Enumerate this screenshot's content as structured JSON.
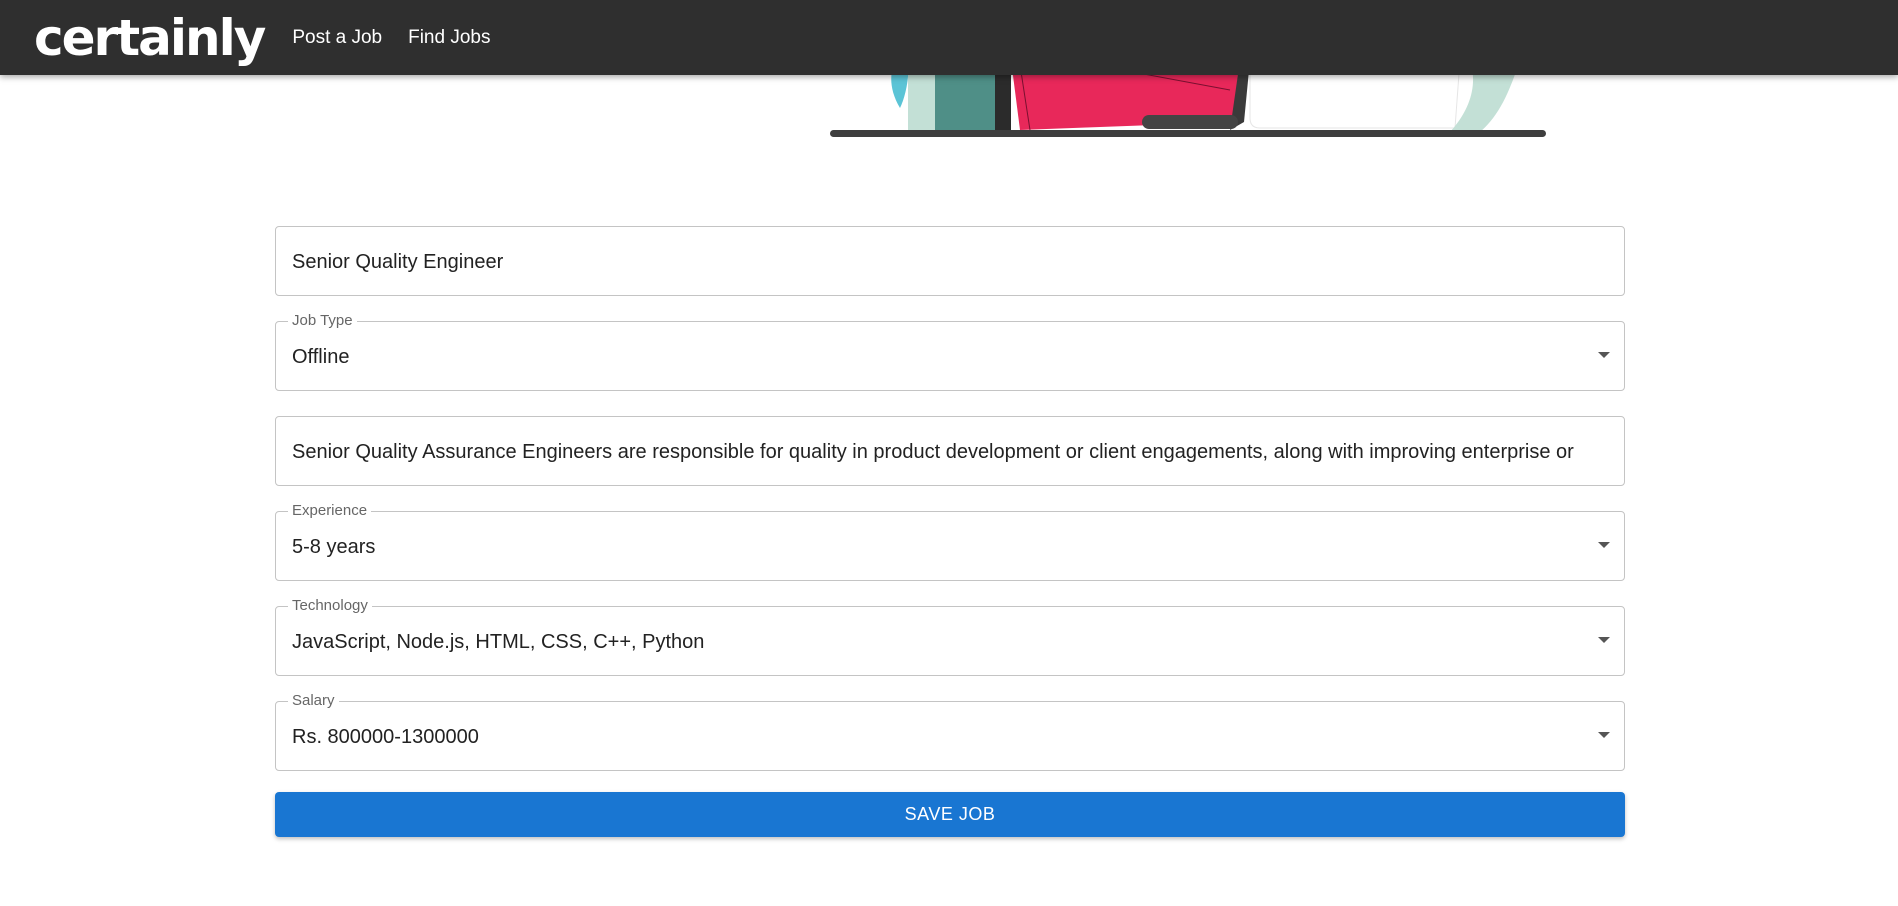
{
  "header": {
    "logo": "certainly",
    "nav": [
      {
        "label": "Post a Job"
      },
      {
        "label": "Find Jobs"
      }
    ]
  },
  "form": {
    "title": {
      "value": "Senior Quality Engineer"
    },
    "job_type": {
      "label": "Job Type",
      "value": "Offline"
    },
    "description": {
      "value": "Senior Quality Assurance Engineers are responsible for quality in product development or client engagements, along with improving enterprise or"
    },
    "experience": {
      "label": "Experience",
      "value": "5-8 years"
    },
    "technology": {
      "label": "Technology",
      "value": "JavaScript, Node.js, HTML, CSS, C++, Python"
    },
    "salary": {
      "label": "Salary",
      "value": "Rs. 800000-1300000"
    },
    "save_label": "SAVE JOB"
  },
  "colors": {
    "header_bg": "#2f2f2f",
    "primary_button": "#1976d2",
    "illustration_pink": "#e8285a",
    "illustration_teal": "#4f8f87",
    "illustration_mint": "#c3e0d6"
  }
}
